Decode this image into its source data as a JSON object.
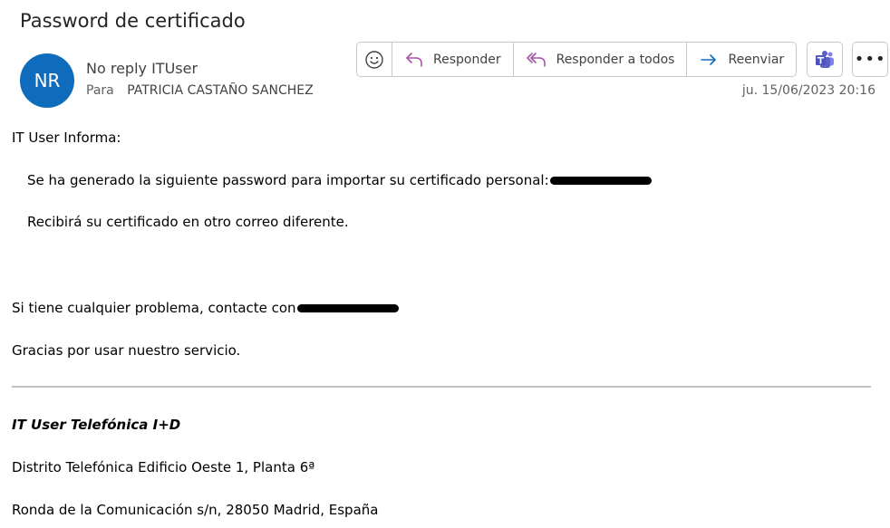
{
  "header": {
    "subject": "Password de certificado",
    "avatar_initials": "NR",
    "sender": "No reply ITUser",
    "to_label": "Para",
    "to_value": "PATRICIA CASTAÑO SANCHEZ",
    "date": "ju. 15/06/2023 20:16"
  },
  "toolbar": {
    "emoji_icon": "emoji-icon",
    "reply_label": "Responder",
    "reply_all_label": "Responder a todos",
    "forward_label": "Reenviar",
    "teams_icon": "teams-icon",
    "more_label": "•••"
  },
  "body": {
    "greeting": "IT User Informa:",
    "line1": "Se ha generado la siguiente password para importar su certificado personal:",
    "line2": "Recibirá su certificado en otro correo diferente.",
    "problem_text": "Si tiene cualquier problema, contacte con",
    "thanks": "Gracias por usar nuestro servicio."
  },
  "signature": {
    "org": "IT User Telefónica I+D",
    "address1": "Distrito Telefónica Edificio Oeste 1, Planta 6ª",
    "address2": "Ronda de la Comunicación s/n, 28050 Madrid, España"
  },
  "colors": {
    "avatar": "#0f6cbd",
    "reply_icon": "#a855a8",
    "forward_icon": "#0f6cbd",
    "teams": "#5b5fc7",
    "link": "#0563c1"
  }
}
